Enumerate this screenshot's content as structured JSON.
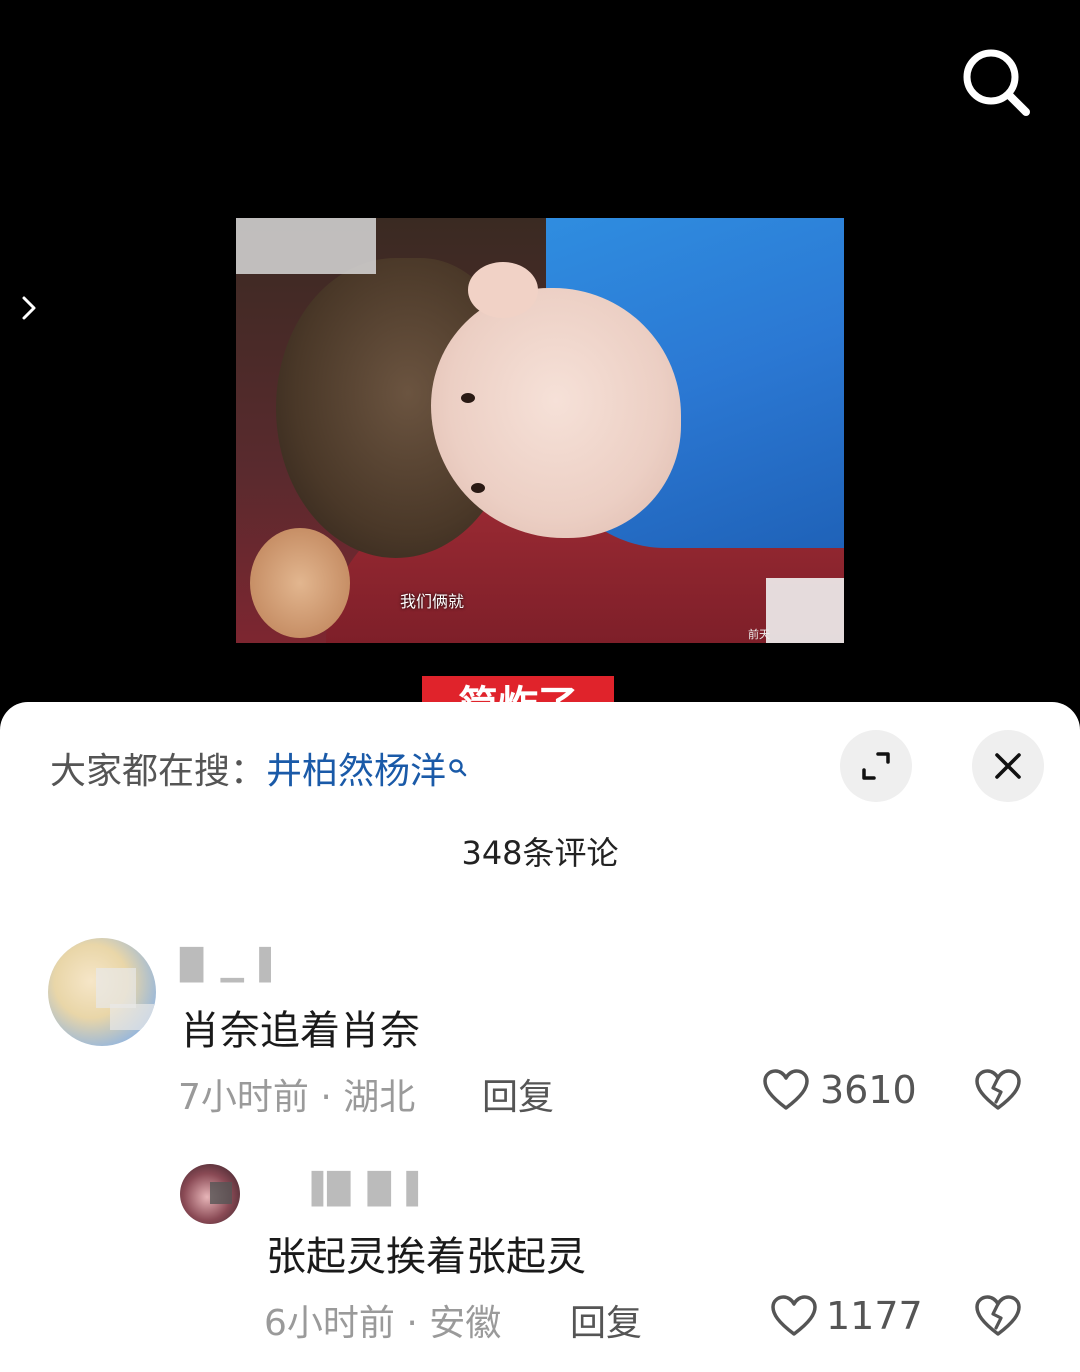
{
  "video": {
    "subtitle": "我们俩就",
    "corner_text": "前天",
    "caption_peek": "简炸了"
  },
  "icons": {
    "search": "search-icon",
    "side_arrow": "chevron-right-icon",
    "expand": "expand-icon",
    "close": "close-icon",
    "like": "heart-outline-icon",
    "dislike": "broken-heart-icon"
  },
  "sheet": {
    "trending_label": "大家都在搜：",
    "trending_term": "井柏然杨洋",
    "comment_count": "348条评论"
  },
  "comments": [
    {
      "username": "█ ▁▐",
      "text": "肖奈追着肖奈",
      "time": "7小时前",
      "location": "湖北",
      "reply_label": "回复",
      "likes": "3610"
    },
    {
      "username": "▐█ █▐",
      "text": "张起灵挨着张起灵",
      "time": "6小时前",
      "location": "安徽",
      "reply_label": "回复",
      "likes": "1177"
    }
  ],
  "colors": {
    "trending_term": "#1a5aa8",
    "caption_bg": "#e0232b"
  }
}
